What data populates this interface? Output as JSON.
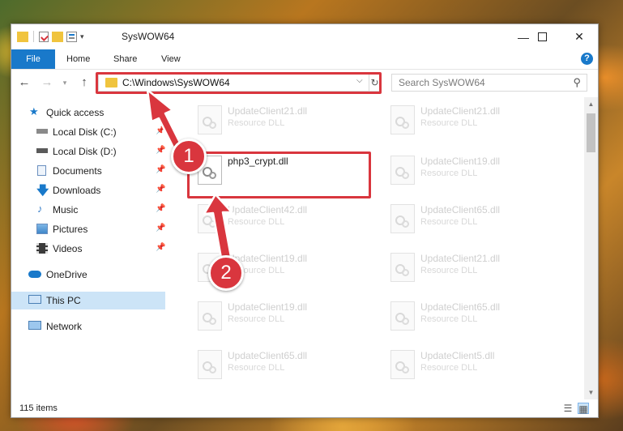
{
  "window": {
    "title": "SysWOW64"
  },
  "ribbon": {
    "tabs": [
      "File",
      "Home",
      "Share",
      "View"
    ],
    "help": "?"
  },
  "address": {
    "path": "C:\\Windows\\SysWOW64"
  },
  "search": {
    "placeholder": "Search SysWOW64"
  },
  "nav": {
    "quick_access": "Quick access",
    "items": [
      "Local Disk (C:)",
      "Local Disk (D:)",
      "Documents",
      "Downloads",
      "Music",
      "Pictures",
      "Videos"
    ],
    "onedrive": "OneDrive",
    "this_pc": "This PC",
    "network": "Network"
  },
  "files": {
    "col1": [
      {
        "name": "UpdateClient21.dll",
        "desc": "Resource DLL"
      },
      {
        "name": "php3_crypt.dll",
        "desc": ""
      },
      {
        "name": "UpdateClient42.dll",
        "desc": "Resource DLL"
      },
      {
        "name": "UpdateClient19.dll",
        "desc": "Resource DLL"
      },
      {
        "name": "UpdateClient19.dll",
        "desc": "Resource DLL"
      },
      {
        "name": "UpdateClient65.dll",
        "desc": "Resource DLL"
      }
    ],
    "col2": [
      {
        "name": "UpdateClient21.dll",
        "desc": "Resource DLL"
      },
      {
        "name": "UpdateClient19.dll",
        "desc": "Resource DLL"
      },
      {
        "name": "UpdateClient65.dll",
        "desc": "Resource DLL"
      },
      {
        "name": "UpdateClient21.dll",
        "desc": "Resource DLL"
      },
      {
        "name": "UpdateClient65.dll",
        "desc": "Resource DLL"
      },
      {
        "name": "UpdateClient5.dll",
        "desc": "Resource DLL"
      }
    ]
  },
  "status": {
    "items": "115 items"
  },
  "annotations": {
    "step1": "1",
    "step2": "2"
  },
  "colors": {
    "accent": "#1979ca",
    "highlight": "#d9363e"
  }
}
